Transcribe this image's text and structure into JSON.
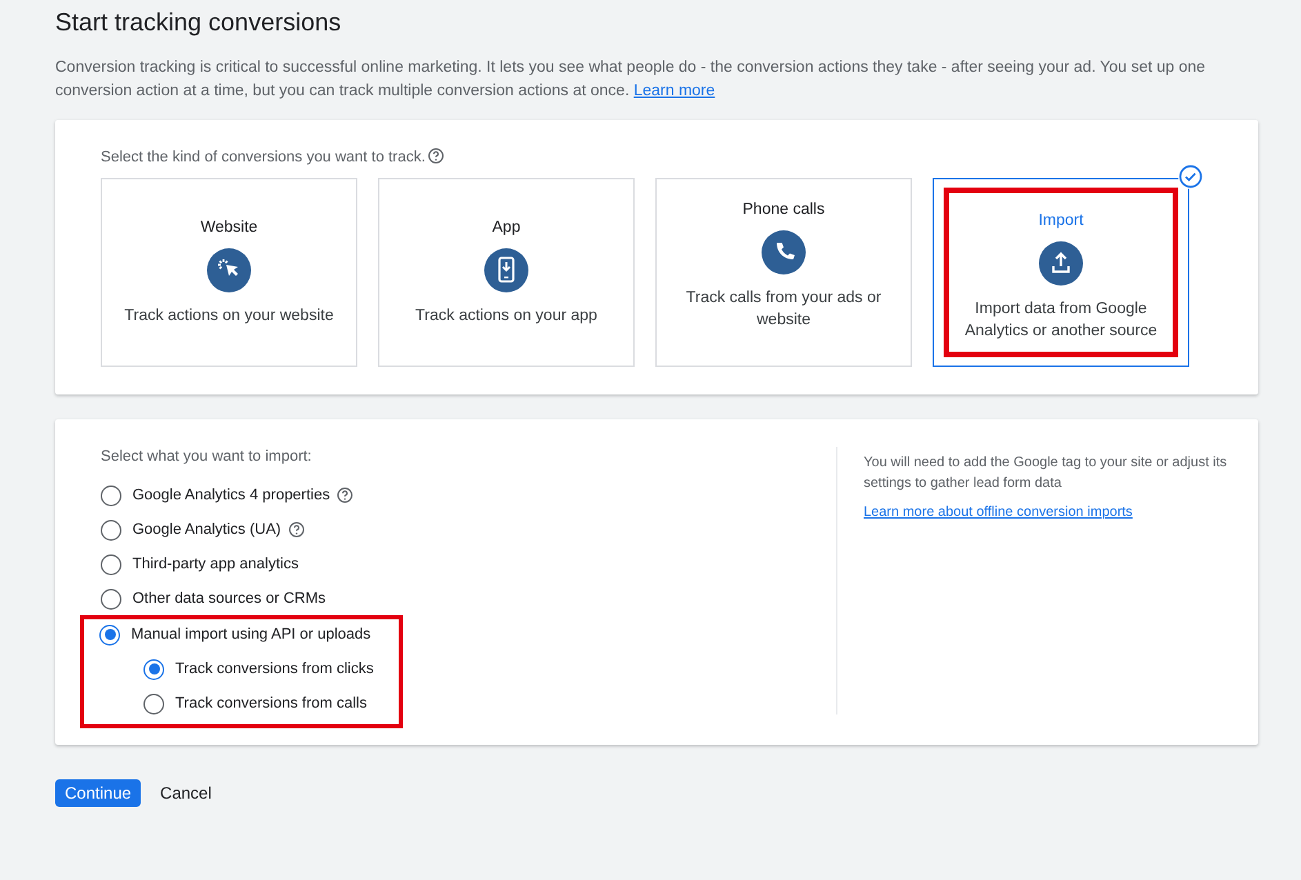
{
  "title": "Start tracking conversions",
  "description": "Conversion tracking is critical to successful online marketing. It lets you see what people do - the conversion actions they take - after seeing your ad. You set up one conversion action at a time, but you can track multiple conversion actions at once.",
  "description_link": "Learn more",
  "kinds": {
    "prompt": "Select the kind of conversions you want to track.",
    "cards": [
      {
        "title": "Website",
        "kind": "website",
        "text": "Track actions on your website",
        "selected": false,
        "highlighted": false
      },
      {
        "title": "App",
        "kind": "app",
        "text": "Track actions on your app",
        "selected": false,
        "highlighted": false
      },
      {
        "title": "Phone calls",
        "kind": "phone",
        "text": "Track calls from your ads or website",
        "selected": false,
        "highlighted": false
      },
      {
        "title": "Import",
        "kind": "import",
        "text": "Import data from Google Analytics or another source",
        "selected": true,
        "highlighted": true
      }
    ]
  },
  "import": {
    "prompt": "Select what you want to import:",
    "options": [
      {
        "label": "Google Analytics 4 properties",
        "help": true,
        "selected": false,
        "highlighted": false
      },
      {
        "label": "Google Analytics (UA)",
        "help": true,
        "selected": false,
        "highlighted": false
      },
      {
        "label": "Third-party app analytics",
        "help": false,
        "selected": false,
        "highlighted": false
      },
      {
        "label": "Other data sources or CRMs",
        "help": false,
        "selected": false,
        "highlighted": false
      },
      {
        "label": "Manual import using API or uploads",
        "help": false,
        "selected": true,
        "highlighted": true,
        "children": [
          {
            "label": "Track conversions from clicks",
            "help": false,
            "selected": true,
            "highlighted": false
          },
          {
            "label": "Track conversions from calls",
            "help": false,
            "selected": false,
            "highlighted": false
          }
        ]
      }
    ],
    "note": "You will need to add the Google tag to your site or adjust its settings to gather lead form data",
    "note_link": "Learn more about offline conversion imports"
  },
  "buttons": [
    {
      "label": "Continue",
      "kind": "primary"
    },
    {
      "label": "Cancel",
      "kind": "text"
    }
  ]
}
